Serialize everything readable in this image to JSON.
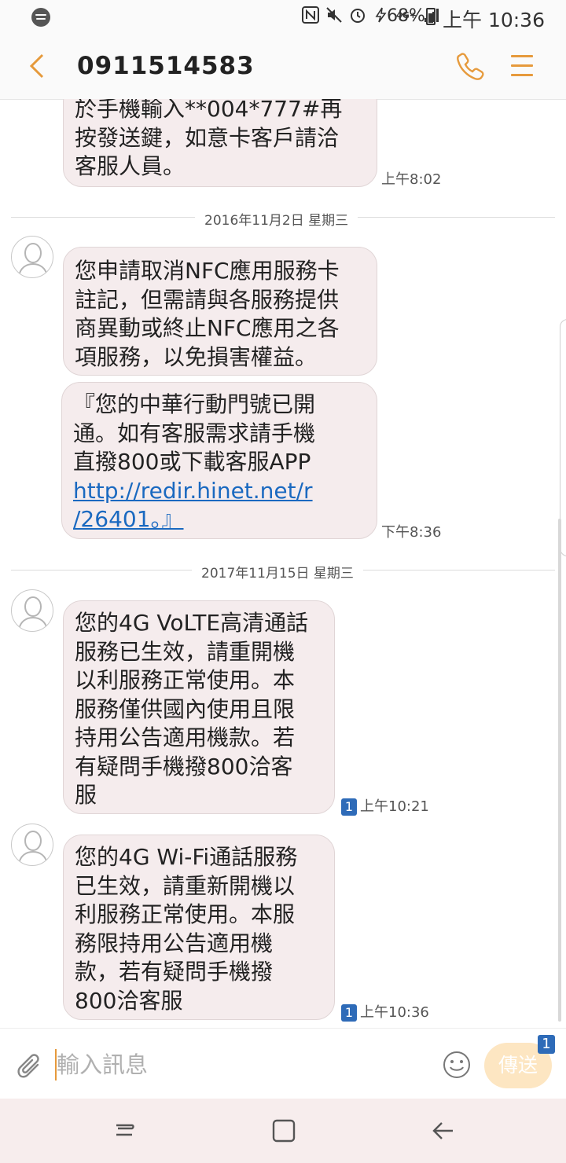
{
  "status": {
    "battery_percent": "68%",
    "clock": "上午 10:36",
    "network": "4G+"
  },
  "header": {
    "contact": "0911514583"
  },
  "conversation": {
    "msg0": {
      "lines": [
        "於手機輸入**004*777#再",
        "按發送鍵，如意卡客戶請洽",
        "客服人員。"
      ],
      "time": "上午8:02"
    },
    "date1": "2016年11月2日 星期三",
    "msg1": {
      "lines": [
        "您申請取消NFC應用服務卡",
        "註記，但需請與各服務提供",
        "商異動或終止NFC應用之各",
        "項服務，以免損害權益。"
      ]
    },
    "msg2": {
      "lines": [
        "『您的中華行動門號已開",
        "通。如有客服需求請手機",
        "直撥800或下載客服APP"
      ],
      "link_lines": [
        "http://redir.hinet.net/r",
        "/26401。』"
      ],
      "time": "下午8:36"
    },
    "date2": "2017年11月15日 星期三",
    "msg3": {
      "lines": [
        "您的4G VoLTE高清通話",
        "服務已生效，請重開機",
        "以利服務正常使用。本",
        "服務僅供國內使用且限",
        "持用公告適用機款。若",
        "有疑問手機撥800洽客",
        "服"
      ],
      "sim": "1",
      "time": "上午10:21"
    },
    "msg4": {
      "lines": [
        "您的4G Wi-Fi通話服務",
        "已生效，請重新開機以",
        "利服務正常使用。本服",
        "務限持用公告適用機",
        "款，若有疑問手機撥",
        "800洽客服"
      ],
      "sim": "1",
      "time": "上午10:36"
    }
  },
  "composer": {
    "placeholder": "輸入訊息",
    "send_label": "傳送",
    "send_sim": "1"
  },
  "colors": {
    "accent": "#e69a3c",
    "bubble": "#f5eced",
    "link": "#1a69c0",
    "sim_badge": "#2e6bb8"
  }
}
